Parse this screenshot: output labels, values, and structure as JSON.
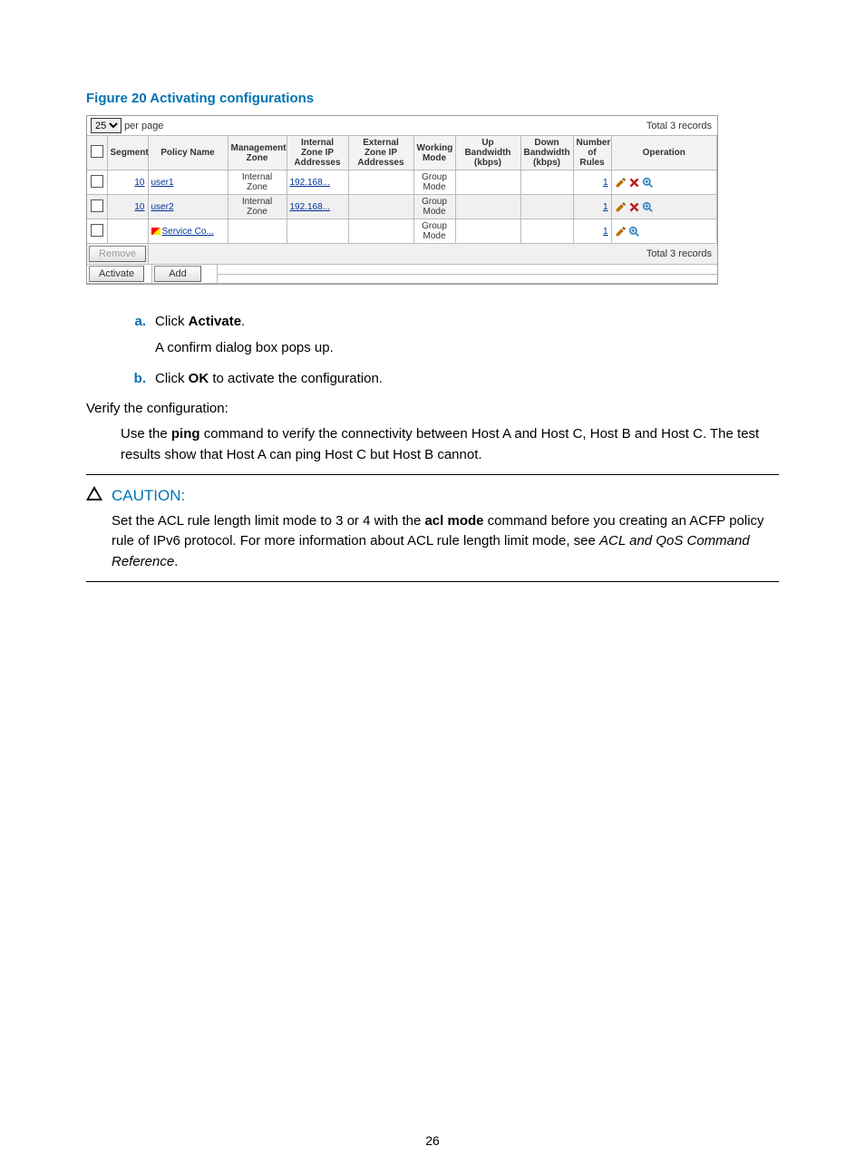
{
  "figure_title": "Figure 20 Activating configurations",
  "pager": {
    "value": "25",
    "label": "per page",
    "total_top": "Total 3 records"
  },
  "headers": {
    "chk": "",
    "segment": "Segment",
    "policy": "Policy Name",
    "mzone": "Management Zone",
    "izone": "Internal Zone IP Addresses",
    "ezone": "External Zone IP Addresses",
    "wmode": "Working Mode",
    "upbw": "Up Bandwidth (kbps)",
    "downbw": "Down Bandwidth (kbps)",
    "rules": "Number of Rules",
    "op": "Operation"
  },
  "rows": [
    {
      "segment": "10",
      "policy": "user1",
      "flag": false,
      "mzone": "Internal Zone",
      "izone": "192.168...",
      "ezone": "",
      "wmode": "Group Mode",
      "upbw": "",
      "downbw": "",
      "rules": "1",
      "ops": [
        "edit",
        "del",
        "zoom"
      ]
    },
    {
      "segment": "10",
      "policy": "user2",
      "flag": false,
      "mzone": "Internal Zone",
      "izone": "192.168...",
      "ezone": "",
      "wmode": "Group Mode",
      "upbw": "",
      "downbw": "",
      "rules": "1",
      "ops": [
        "edit",
        "del",
        "zoom"
      ]
    },
    {
      "segment": "",
      "policy": "Service Co...",
      "flag": true,
      "mzone": "",
      "izone": "",
      "ezone": "",
      "wmode": "Group Mode",
      "upbw": "",
      "downbw": "",
      "rules": "1",
      "ops": [
        "edit",
        "zoom"
      ]
    }
  ],
  "totals": {
    "remove_btn": "Remove",
    "total_bottom": "Total 3 records",
    "activate_btn": "Activate",
    "add_btn": "Add"
  },
  "steps": {
    "a": {
      "letter": "a.",
      "text_pre": "Click ",
      "bold": "Activate",
      "text_post": ".",
      "sub": "A confirm dialog box pops up."
    },
    "b": {
      "letter": "b.",
      "text_pre": "Click ",
      "bold": "OK",
      "text_post": " to activate the configuration."
    }
  },
  "verify": {
    "lead": "Verify the configuration:",
    "body_pre": "Use the ",
    "body_bold": "ping",
    "body_post": " command to verify the connectivity between Host A and Host C, Host B and Host C. The test results show that Host A can ping Host C but Host B cannot."
  },
  "caution": {
    "label": "CAUTION:",
    "pre": "Set the ACL rule length limit mode to 3 or 4 with the ",
    "bold": "acl mode",
    "mid": " command before you creating an ACFP policy rule of IPv6 protocol. For more information about ACL rule length limit mode, see ",
    "ital": "ACL and QoS Command Reference",
    "post": "."
  },
  "page_number": "26"
}
